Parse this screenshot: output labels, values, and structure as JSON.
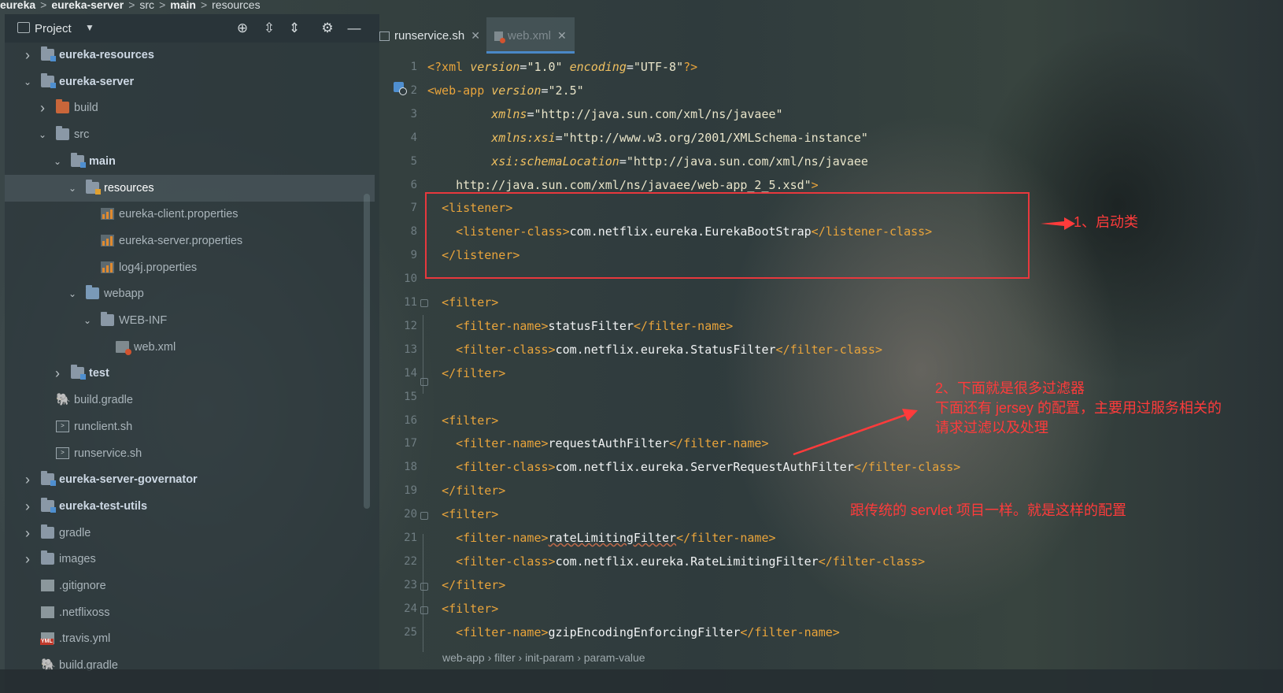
{
  "window": {
    "breadcrumb": [
      "eureka",
      "eureka-server",
      "src",
      "main",
      "resources"
    ]
  },
  "project_panel": {
    "title": "Project",
    "tree": [
      {
        "label": "eureka-resources",
        "kind": "module-folder",
        "bold": true,
        "expanded": false
      },
      {
        "label": "eureka-server",
        "kind": "module-folder",
        "bold": true,
        "expanded": true
      },
      {
        "label": "build",
        "kind": "orange-folder",
        "expanded": false
      },
      {
        "label": "src",
        "kind": "folder",
        "expanded": true
      },
      {
        "label": "main",
        "kind": "module-folder",
        "bold": true,
        "expanded": true
      },
      {
        "label": "resources",
        "kind": "resources-folder",
        "expanded": true,
        "selected": true
      },
      {
        "label": "eureka-client.properties",
        "kind": "properties-file"
      },
      {
        "label": "eureka-server.properties",
        "kind": "properties-file"
      },
      {
        "label": "log4j.properties",
        "kind": "properties-file"
      },
      {
        "label": "webapp",
        "kind": "web-folder",
        "expanded": true
      },
      {
        "label": "WEB-INF",
        "kind": "folder",
        "expanded": true
      },
      {
        "label": "web.xml",
        "kind": "xml-file"
      },
      {
        "label": "test",
        "kind": "module-folder",
        "bold": true,
        "expanded": false
      },
      {
        "label": "build.gradle",
        "kind": "gradle-file"
      },
      {
        "label": "runclient.sh",
        "kind": "shell-file"
      },
      {
        "label": "runservice.sh",
        "kind": "shell-file"
      },
      {
        "label": "eureka-server-governator",
        "kind": "module-folder",
        "bold": true,
        "expanded": false
      },
      {
        "label": "eureka-test-utils",
        "kind": "module-folder",
        "bold": true,
        "expanded": false
      },
      {
        "label": "gradle",
        "kind": "folder",
        "expanded": false
      },
      {
        "label": "images",
        "kind": "folder",
        "expanded": false
      },
      {
        "label": ".gitignore",
        "kind": "generic-file"
      },
      {
        "label": ".netflixoss",
        "kind": "generic-file"
      },
      {
        "label": ".travis.yml",
        "kind": "yml-file"
      },
      {
        "label": "build.gradle",
        "kind": "gradle-file"
      }
    ]
  },
  "editor": {
    "tabs": [
      {
        "label": "runservice.sh",
        "active": false
      },
      {
        "label": "web.xml",
        "active": true
      }
    ],
    "line_numbers": [
      "1",
      "2",
      "3",
      "4",
      "5",
      "6",
      "7",
      "8",
      "9",
      "10",
      "11",
      "12",
      "13",
      "14",
      "15",
      "16",
      "17",
      "18",
      "19",
      "20",
      "21",
      "22",
      "23",
      "24",
      "25"
    ],
    "lines": [
      [
        [
          "t",
          "<?xml "
        ],
        [
          "a",
          "version"
        ],
        [
          "b",
          "="
        ],
        [
          "v",
          "\"1.0\""
        ],
        [
          "b",
          " "
        ],
        [
          "a",
          "encoding"
        ],
        [
          "b",
          "="
        ],
        [
          "v",
          "\"UTF-8\""
        ],
        [
          "t",
          "?>"
        ]
      ],
      [
        [
          "t",
          "<web-app "
        ],
        [
          "a",
          "version"
        ],
        [
          "b",
          "="
        ],
        [
          "v",
          "\"2.5\""
        ]
      ],
      [
        [
          "b",
          "         "
        ],
        [
          "a",
          "xmlns"
        ],
        [
          "b",
          "="
        ],
        [
          "v",
          "\"http://java.sun.com/xml/ns/javaee\""
        ]
      ],
      [
        [
          "b",
          "         "
        ],
        [
          "a",
          "xmlns:xsi"
        ],
        [
          "b",
          "="
        ],
        [
          "v",
          "\"http://www.w3.org/2001/XMLSchema-instance\""
        ]
      ],
      [
        [
          "b",
          "         "
        ],
        [
          "a",
          "xsi:schemaLocation"
        ],
        [
          "b",
          "="
        ],
        [
          "v",
          "\"http://java.sun.com/xml/ns/javaee"
        ]
      ],
      [
        [
          "v",
          "    http://java.sun.com/xml/ns/javaee/web-app_2_5.xsd\""
        ],
        [
          "t",
          ">"
        ]
      ],
      [
        [
          "b",
          "  "
        ],
        [
          "t",
          "<listener>"
        ]
      ],
      [
        [
          "b",
          "    "
        ],
        [
          "t",
          "<listener-class>"
        ],
        [
          "txt",
          "com.netflix.eureka.EurekaBootStrap"
        ],
        [
          "t",
          "</listener-class>"
        ]
      ],
      [
        [
          "b",
          "  "
        ],
        [
          "t",
          "</listener>"
        ]
      ],
      [
        [
          "b",
          ""
        ]
      ],
      [
        [
          "b",
          "  "
        ],
        [
          "t",
          "<filter>"
        ]
      ],
      [
        [
          "b",
          "    "
        ],
        [
          "t",
          "<filter-name>"
        ],
        [
          "txt",
          "statusFilter"
        ],
        [
          "t",
          "</filter-name>"
        ]
      ],
      [
        [
          "b",
          "    "
        ],
        [
          "t",
          "<filter-class>"
        ],
        [
          "txt",
          "com.netflix.eureka.StatusFilter"
        ],
        [
          "t",
          "</filter-class>"
        ]
      ],
      [
        [
          "b",
          "  "
        ],
        [
          "t",
          "</filter>"
        ]
      ],
      [
        [
          "b",
          ""
        ]
      ],
      [
        [
          "b",
          "  "
        ],
        [
          "t",
          "<filter>"
        ]
      ],
      [
        [
          "b",
          "    "
        ],
        [
          "t",
          "<filter-name>"
        ],
        [
          "txt",
          "requestAuthFilter"
        ],
        [
          "t",
          "</filter-name>"
        ]
      ],
      [
        [
          "b",
          "    "
        ],
        [
          "t",
          "<filter-class>"
        ],
        [
          "txt",
          "com.netflix.eureka.ServerRequestAuthFilter"
        ],
        [
          "t",
          "</filter-class>"
        ]
      ],
      [
        [
          "b",
          "  "
        ],
        [
          "t",
          "</filter>"
        ]
      ],
      [
        [
          "b",
          "  "
        ],
        [
          "t",
          "<filter>"
        ]
      ],
      [
        [
          "b",
          "    "
        ],
        [
          "t",
          "<filter-name>"
        ],
        [
          "wavy",
          "rateLimitingFilter"
        ],
        [
          "t",
          "</filter-name>"
        ]
      ],
      [
        [
          "b",
          "    "
        ],
        [
          "t",
          "<filter-class>"
        ],
        [
          "txt",
          "com.netflix.eureka.RateLimitingFilter"
        ],
        [
          "t",
          "</filter-class>"
        ]
      ],
      [
        [
          "b",
          "  "
        ],
        [
          "t",
          "</filter>"
        ]
      ],
      [
        [
          "b",
          "  "
        ],
        [
          "t",
          "<filter>"
        ]
      ],
      [
        [
          "b",
          "    "
        ],
        [
          "t",
          "<filter-name>"
        ],
        [
          "txt",
          "gzipEncodingEnforcingFilter"
        ],
        [
          "t",
          "</filter-name>"
        ]
      ]
    ],
    "bottom_breadcrumb": [
      "web-app",
      "filter",
      "init-param",
      "param-value"
    ]
  },
  "annotations": {
    "arrow1_text": "1、启动类",
    "note2_line1": "2、下面就是很多过滤器",
    "note2_line2": "下面还有 jersey 的配置，主要用过服务相关的",
    "note2_line3": "请求过滤以及处理",
    "note3": "跟传统的 servlet 项目一样。就是这样的配置",
    "color": "#ff3b3b"
  }
}
